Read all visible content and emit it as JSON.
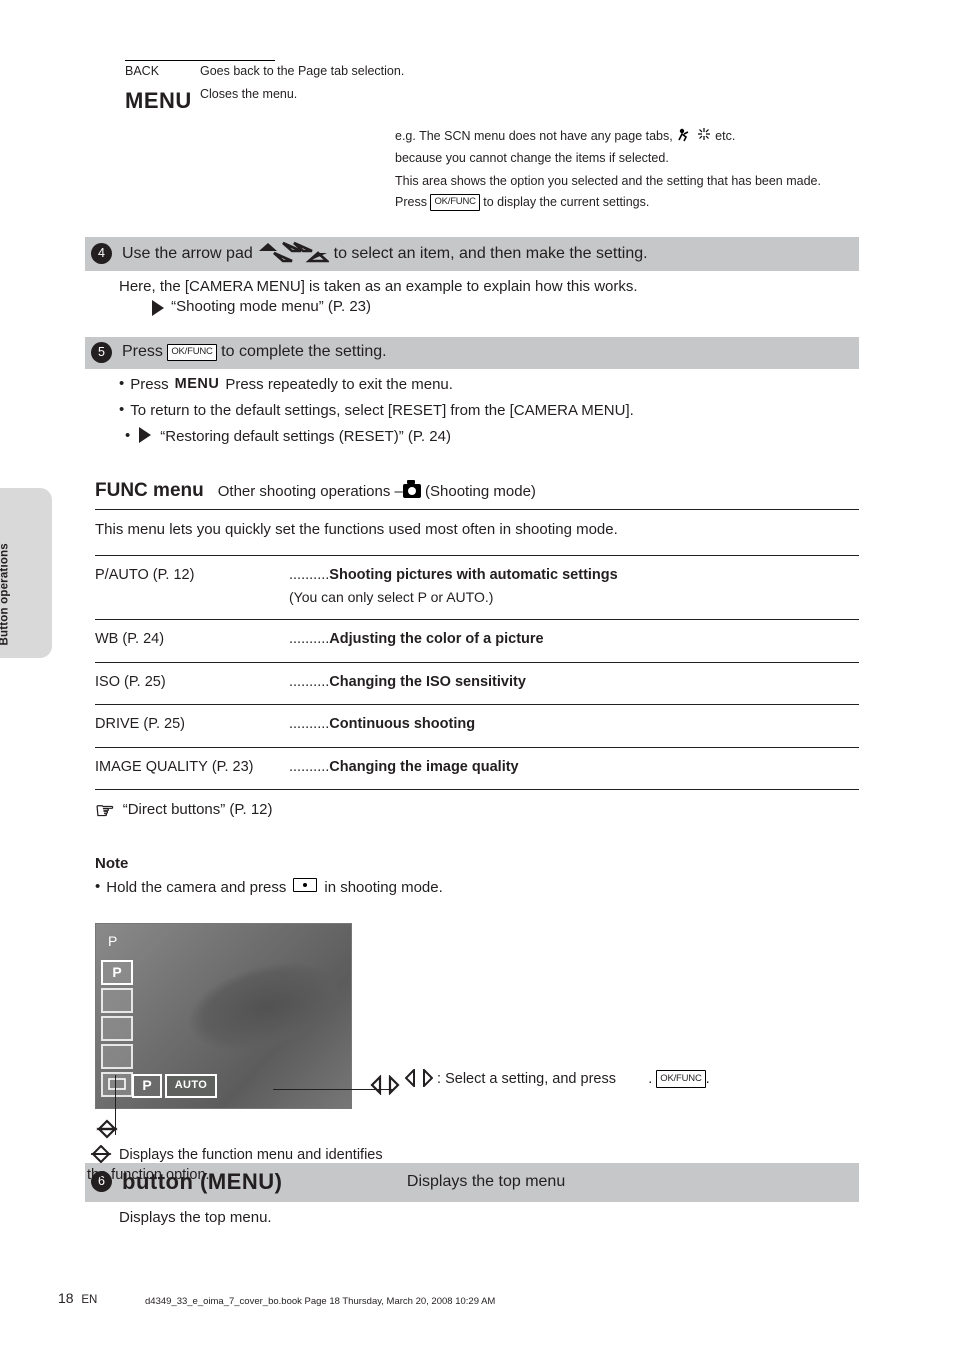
{
  "form": {
    "back_label": "BACK",
    "menu_label": "MENU",
    "back_hint": "Goes back to the Page tab selection.",
    "menu_hint": "Closes the menu.",
    "top_hint_1": "e.g. The SCN menu does not have any page tabs,",
    "top_hint_2": "because you cannot change the items if selected.",
    "top_hint_3": "This area shows the option you selected and the setting that has been made.",
    "top_hint_4": "Press         to display the current settings."
  },
  "step4": {
    "title_prefix": "Use the arrow pad             to select an item, and then make the setting.",
    "body": "Here, the [CAMERA MENU] is taken as an example to explain how this works.",
    "ref": "“Shooting mode menu” (P. 23)"
  },
  "step5": {
    "title": "Press         to complete the setting.",
    "bullet1": "Press             repeatedly to exit the menu.",
    "bullet2": "To return to the default settings, select [RESET] from the [CAMERA MENU].",
    "bullet2_ref": "“Restoring default settings (RESET)” (P. 24)"
  },
  "funcmenu": {
    "heading": "FUNC menu",
    "sub": "Other shooting operations –",
    "sub2": " (Shooting mode)",
    "intro": "This menu lets you quickly set the functions used most often in shooting mode.",
    "rows": [
      {
        "label": "P/AUTO",
        "ref": "(P. 12)",
        "desc_bold": "Shooting pictures with automatic settings",
        "desc_rest": " (You can only select P or AUTO.)"
      },
      {
        "label": "WB",
        "ref": "(P. 24)",
        "desc_bold": "Adjusting the color of a picture"
      },
      {
        "label": "ISO",
        "ref": "(P. 25)",
        "desc_bold": "Changing the ISO sensitivity"
      },
      {
        "label": "DRIVE",
        "ref": "(P. 25)",
        "desc_bold": "Continuous shooting"
      },
      {
        "label": "IMAGE QUALITY",
        "ref": "(P. 23)",
        "desc_bold": "Changing the image quality"
      }
    ],
    "ref_text": "“Direct buttons” (P. 12)",
    "note_title": "Note",
    "note_body_before": "Hold the camera and press ",
    "note_body_after": " in shooting mode.",
    "right_label": ": Select a setting, and press        .",
    "below_label": " Displays the function menu and identifies the function option."
  },
  "step6": {
    "title": " button (MENU)",
    "sub": "Displays the top menu",
    "body": "Displays the top menu."
  },
  "sidetab": "Button operations",
  "page_number": "18",
  "footer_brand": "EN",
  "footer_file": "d4349_33_e_oima_7_cover_bo.book  Page 18  Thursday, March 20, 2008  10:29 AM"
}
